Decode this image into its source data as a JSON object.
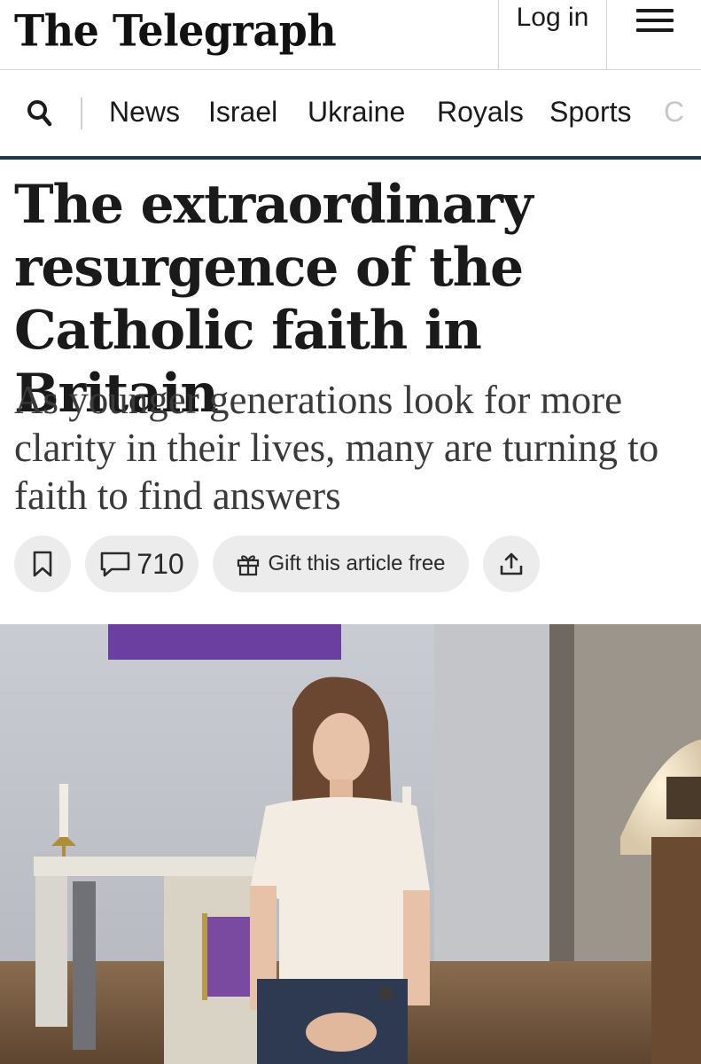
{
  "header": {
    "logo_text": "The Telegraph",
    "login_label": "Log in",
    "menu_icon": "hamburger-menu-icon"
  },
  "nav": {
    "search_icon": "search-icon",
    "items": [
      "News",
      "Israel",
      "Ukraine",
      "Royals",
      "Sports",
      "C"
    ]
  },
  "article": {
    "headline": "The extraordinary resurgence of the Catholic faith in Britain",
    "standfirst": "As younger generations look for more clarity in their lives, many are turning to faith to find answers",
    "actions": {
      "comment_count": "710",
      "gift_label": "Gift this article free",
      "bookmark_icon": "bookmark-icon",
      "comment_icon": "comment-icon",
      "gift_icon": "gift-icon",
      "share_icon": "share-icon"
    }
  },
  "colors": {
    "nav_rule": "#1f3a45",
    "action_bg": "#ececec",
    "headline_text": "#1a1a1a"
  }
}
